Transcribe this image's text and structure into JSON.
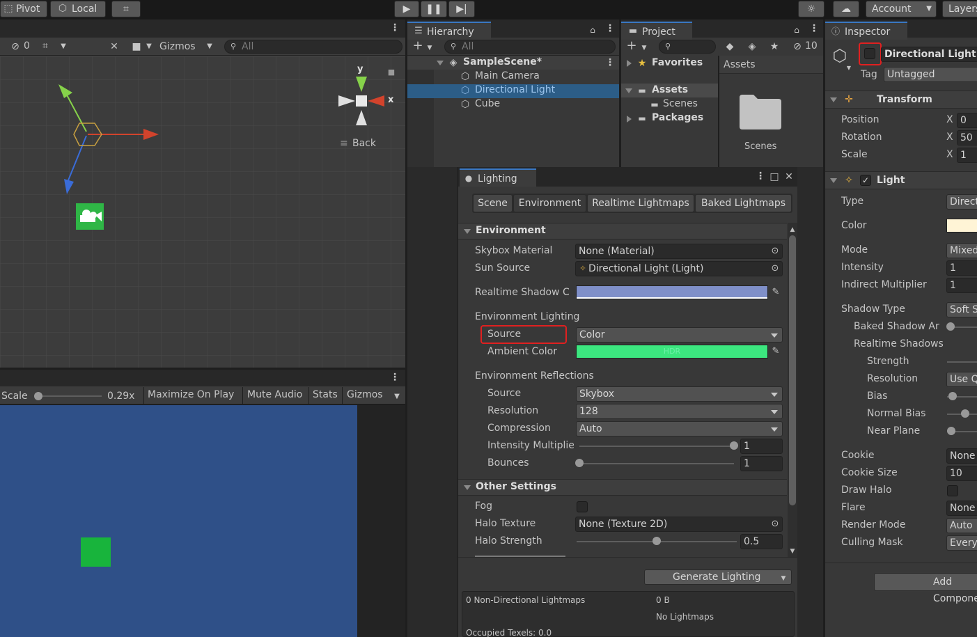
{
  "toolbar": {
    "pivot": "Pivot",
    "local": "Local",
    "account": "Account",
    "layers": "Layers"
  },
  "scene": {
    "hidden_count": "0",
    "gizmos": "Gizmos",
    "search_placeholder": "All",
    "gizmo_y": "y",
    "gizmo_x": "x",
    "view_label": "Back"
  },
  "game": {
    "scale_label": "Scale",
    "scale_value": "0.29x",
    "maximize": "Maximize On Play",
    "mute": "Mute Audio",
    "stats": "Stats",
    "gizmos": "Gizmos"
  },
  "hierarchy": {
    "tab": "Hierarchy",
    "search_placeholder": "All",
    "scene_name": "SampleScene*",
    "items": [
      "Main Camera",
      "Directional Light",
      "Cube"
    ]
  },
  "project": {
    "tab": "Project",
    "hidden_count": "10",
    "favorites": "Favorites",
    "assets": "Assets",
    "scenes": "Scenes",
    "packages": "Packages",
    "breadcrumb": "Assets",
    "folder_label": "Scenes"
  },
  "lighting": {
    "tab": "Lighting",
    "tabs": [
      "Scene",
      "Environment",
      "Realtime Lightmaps",
      "Baked Lightmaps"
    ],
    "environment_header": "Environment",
    "skybox_material_label": "Skybox Material",
    "skybox_material_value": "None (Material)",
    "sun_source_label": "Sun Source",
    "sun_source_value": "Directional Light (Light)",
    "realtime_shadow_label": "Realtime Shadow C",
    "realtime_shadow_color": "#7f8fc8",
    "env_lighting_label": "Environment Lighting",
    "source_label": "Source",
    "source_value": "Color",
    "ambient_label": "Ambient Color",
    "ambient_color": "#3ce67f",
    "ambient_hdr": "HDR",
    "env_reflections_label": "Environment Reflections",
    "refl_source_label": "Source",
    "refl_source_value": "Skybox",
    "resolution_label": "Resolution",
    "resolution_value": "128",
    "compression_label": "Compression",
    "compression_value": "Auto",
    "intensity_label": "Intensity Multiplie",
    "intensity_value": "1",
    "intensity_fraction": 1.0,
    "bounces_label": "Bounces",
    "bounces_value": "1",
    "bounces_fraction": 0.0,
    "other_header": "Other Settings",
    "fog_label": "Fog",
    "halo_texture_label": "Halo Texture",
    "halo_texture_value": "None (Texture 2D)",
    "halo_strength_label": "Halo Strength",
    "halo_strength_value": "0.5",
    "halo_strength_fraction": 0.5,
    "generate_button": "Generate Lighting",
    "stats_left_1": "0 Non-Directional Lightmaps",
    "stats_right_1": "0 B",
    "stats_right_2": "No Lightmaps",
    "stats_left_3": "Occupied Texels: 0.0"
  },
  "inspector": {
    "tab": "Inspector",
    "object_name": "Directional Light",
    "tag_label": "Tag",
    "tag_value": "Untagged",
    "transform_header": "Transform",
    "position_label": "Position",
    "position_x": "0",
    "rotation_label": "Rotation",
    "rotation_x": "50",
    "scale_label": "Scale",
    "scale_x": "1",
    "axis_x": "X",
    "light_header": "Light",
    "type_label": "Type",
    "type_value": "Directional",
    "color_label": "Color",
    "light_color": "#fff4d6",
    "mode_label": "Mode",
    "mode_value": "Mixed",
    "intensity_label": "Intensity",
    "intensity_value": "1",
    "indirect_label": "Indirect Multiplier",
    "indirect_value": "1",
    "shadow_type_label": "Shadow Type",
    "shadow_type_value": "Soft Shadows",
    "baked_shadow_label": "Baked Shadow Ar",
    "realtime_shadows_label": "Realtime Shadows",
    "strength_label": "Strength",
    "resolution_label": "Resolution",
    "resolution_value": "Use Quality Settings",
    "bias_label": "Bias",
    "normal_bias_label": "Normal Bias",
    "near_plane_label": "Near Plane",
    "cookie_label": "Cookie",
    "cookie_value": "None",
    "cookie_size_label": "Cookie Size",
    "cookie_size_value": "10",
    "draw_halo_label": "Draw Halo",
    "flare_label": "Flare",
    "flare_value": "None",
    "render_mode_label": "Render Mode",
    "render_mode_value": "Auto",
    "culling_label": "Culling Mask",
    "culling_value": "Everything",
    "add_component": "Add Component"
  }
}
